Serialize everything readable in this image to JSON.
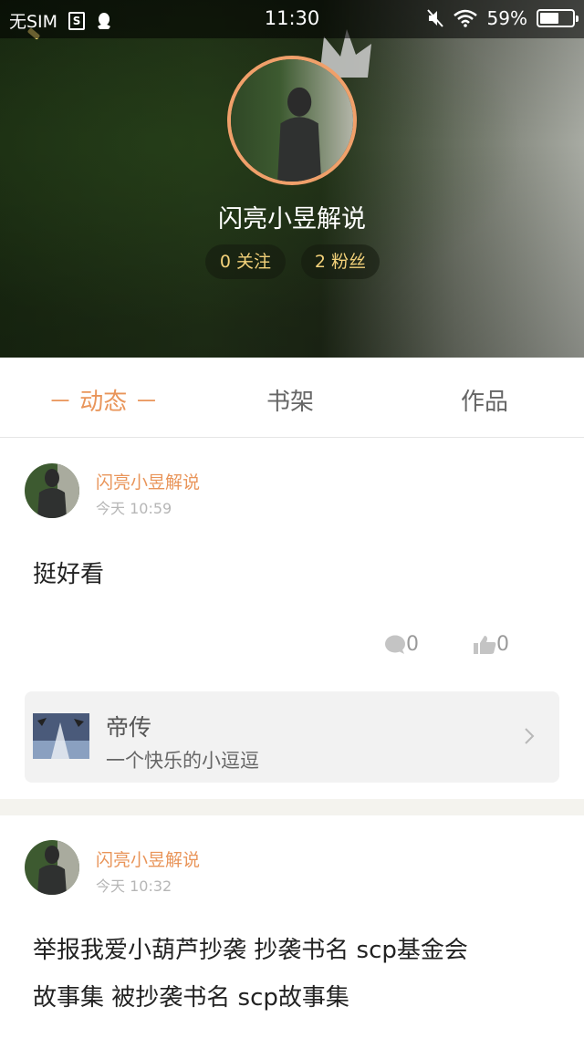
{
  "status_bar": {
    "carrier": "无SIM",
    "sim_icon_label": "S",
    "time": "11:30",
    "battery": "59%",
    "battery_level": 0.59,
    "icons": [
      "sim-card-icon",
      "qq-penguin-icon",
      "mute-icon",
      "wifi-icon",
      "battery-icon"
    ]
  },
  "profile": {
    "name": "闪亮小昱解说",
    "follow": "0 关注",
    "fans": "2 粉丝",
    "accent_color": "#e9955a",
    "pill_text_color": "#f4d27a"
  },
  "tabs": [
    {
      "label": "－ 动态 －",
      "active": true
    },
    {
      "label": "书架",
      "active": false
    },
    {
      "label": "作品",
      "active": false
    }
  ],
  "posts": [
    {
      "author": "闪亮小昱解说",
      "time": "今天 10:59",
      "text": "挺好看",
      "comments": "0",
      "likes": "0",
      "book": {
        "title": "帝传",
        "subtitle": "一个快乐的小逗逗"
      }
    },
    {
      "author": "闪亮小昱解说",
      "time": "今天 10:32",
      "text_line1": "举报我爱小葫芦抄袭 抄袭书名 scp基金会",
      "text_line2": "故事集 被抄袭书名 scp故事集"
    }
  ]
}
